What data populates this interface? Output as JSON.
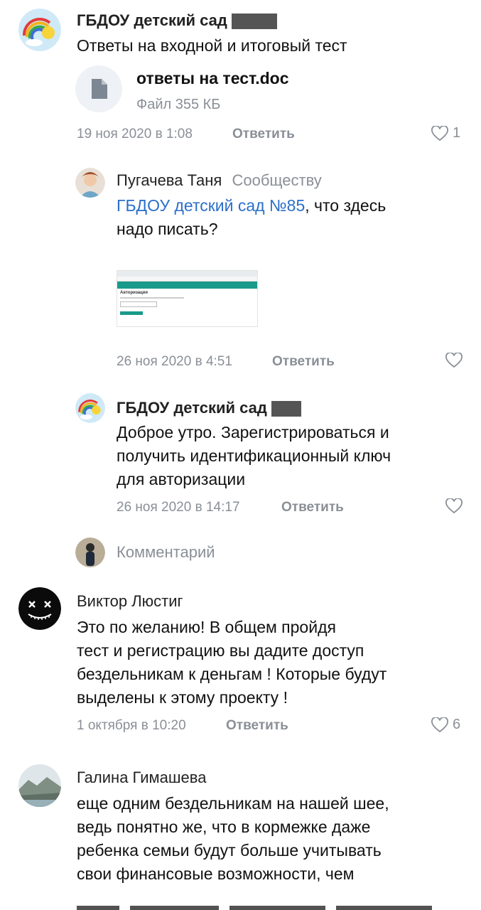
{
  "comments": [
    {
      "author": "ГБДОУ детский сад",
      "text": "Ответы на входной и итоговый тест",
      "attachment": {
        "name": "ответы на тест.doc",
        "meta": "Файл 355 КБ"
      },
      "date": "19 ноя 2020 в 1:08",
      "reply_label": "Ответить",
      "likes": "1"
    },
    {
      "author": "Пугачева Таня",
      "to_label": "Сообществу",
      "mention": "ГБДОУ детский сад №85",
      "text_line1_rest": ", что здесь",
      "text_line2": "надо писать?",
      "date": "26 ноя 2020 в 4:51",
      "reply_label": "Ответить"
    },
    {
      "author": "ГБДОУ детский сад",
      "text_lines": [
        "Доброе утро. Зарегистрироваться и",
        "получить идентификационный ключ",
        "для авторизации"
      ],
      "date": "26 ноя 2020 в 14:17",
      "reply_label": "Ответить"
    },
    {
      "author": "Виктор Люстиг",
      "text_lines": [
        "Это по желанию! В общем пройдя",
        "тест и регистрацию вы дадите доступ",
        "бездельникам к деньгам ! Которые будут",
        "выделены к этому проекту !"
      ],
      "date": "1 октября в 10:20",
      "reply_label": "Ответить",
      "likes": "6"
    },
    {
      "author": "Галина Гимашева",
      "text_lines": [
        "еще одним бездельникам на нашей шее,",
        "ведь понятно же, что в кормежке даже",
        "ребенка семьи будут больше учитывать",
        "свои финансовые возможности, чем"
      ]
    }
  ],
  "comment_input": {
    "placeholder": "Комментарий"
  },
  "screenshot_thumb": {
    "heading": "Авторизация"
  },
  "icons": {
    "file": "document-icon",
    "like": "heart-icon"
  },
  "colors": {
    "link": "#2a6fc9",
    "muted": "#8a8f96",
    "thumb_bar": "#1a9a8a"
  }
}
